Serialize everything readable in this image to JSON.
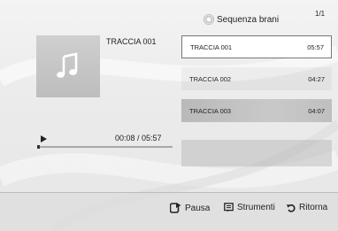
{
  "header": {
    "sequence_label": "Sequenza brani",
    "page_indicator": "1/1"
  },
  "now_playing": {
    "title": "TRACCIA 001",
    "time": "00:08 / 05:57",
    "progress": 0.02
  },
  "tracks": [
    {
      "name": "TRACCIA 001",
      "duration": "05:57"
    },
    {
      "name": "TRACCIA 002",
      "duration": "04:27"
    },
    {
      "name": "TRACCIA 003",
      "duration": "04:07"
    }
  ],
  "footer": {
    "pause_label": "Pausa",
    "tools_label": "Strumenti",
    "return_label": "Ritorna"
  },
  "colors": {
    "accent": "#222222",
    "selected_row": "#ffffff",
    "highlight_row": "#c2c2c2"
  }
}
